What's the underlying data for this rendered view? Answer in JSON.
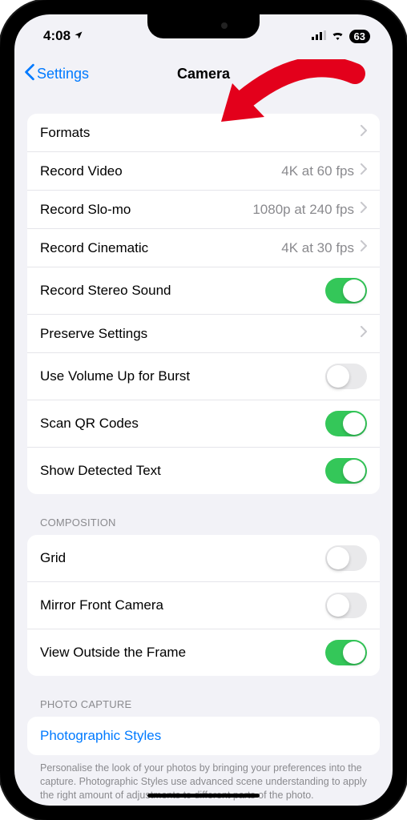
{
  "status": {
    "time": "4:08",
    "battery": "63"
  },
  "nav": {
    "back": "Settings",
    "title": "Camera"
  },
  "main_group": {
    "formats": "Formats",
    "record_video": {
      "label": "Record Video",
      "value": "4K at 60 fps"
    },
    "record_slomo": {
      "label": "Record Slo-mo",
      "value": "1080p at 240 fps"
    },
    "record_cinematic": {
      "label": "Record Cinematic",
      "value": "4K at 30 fps"
    },
    "stereo": {
      "label": "Record Stereo Sound",
      "on": true
    },
    "preserve": "Preserve Settings",
    "volume_burst": {
      "label": "Use Volume Up for Burst",
      "on": false
    },
    "scan_qr": {
      "label": "Scan QR Codes",
      "on": true
    },
    "detected_text": {
      "label": "Show Detected Text",
      "on": true
    }
  },
  "composition": {
    "header": "COMPOSITION",
    "grid": {
      "label": "Grid",
      "on": false
    },
    "mirror": {
      "label": "Mirror Front Camera",
      "on": false
    },
    "outside_frame": {
      "label": "View Outside the Frame",
      "on": true
    }
  },
  "photo_capture": {
    "header": "PHOTO CAPTURE",
    "styles": "Photographic Styles",
    "footer": "Personalise the look of your photos by bringing your preferences into the capture. Photographic Styles use advanced scene understanding to apply the right amount of adjustments to different parts of the photo."
  }
}
